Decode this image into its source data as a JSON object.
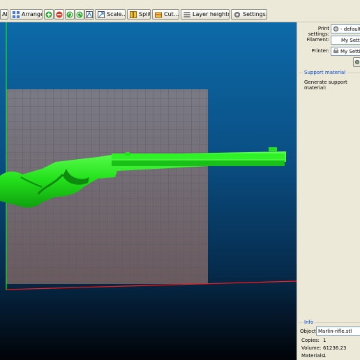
{
  "toolbar": {
    "all_label": "All",
    "arrange_label": "Arrange",
    "scale_label": "Scale...",
    "split_label": "Split",
    "cut_label": "Cut...",
    "layer_heights_label": "Layer heights...",
    "settings_label": "Settings..."
  },
  "presets": {
    "print_settings_label": "Print settings:",
    "print_settings_value": "- default",
    "filament_label": "Filament:",
    "filament_value": "My Settings",
    "printer_label": "Printer:",
    "printer_value": "My Settings"
  },
  "support": {
    "title": "Support material",
    "generate_label": "Generate support material:"
  },
  "info": {
    "title": "Info",
    "object_label": "Object:",
    "object_value": "Marlin-rifle.stl",
    "copies_label": "Copies:",
    "copies_value": "1",
    "volume_label": "Volume:",
    "volume_value": "61236.23",
    "materials_label": "Materials:",
    "materials_value": "1"
  },
  "colors": {
    "model": "#22e01a",
    "bed": "#7b7b86",
    "x_axis": "#ff1a1a",
    "y_axis": "#22dd22",
    "panel_accent": "#0046d5"
  },
  "icons": [
    "plus-icon",
    "minus-icon",
    "rotate-left-icon",
    "rotate-right-icon",
    "mirror-icon",
    "scale-icon",
    "cut-icon",
    "layers-icon",
    "settings-icon"
  ]
}
